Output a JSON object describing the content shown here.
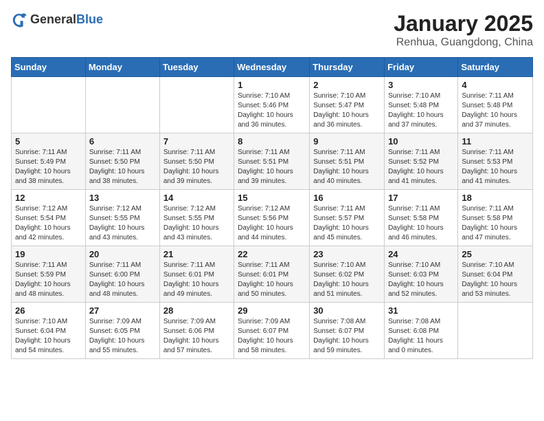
{
  "header": {
    "logo_general": "General",
    "logo_blue": "Blue",
    "month_title": "January 2025",
    "location": "Renhua, Guangdong, China"
  },
  "days_of_week": [
    "Sunday",
    "Monday",
    "Tuesday",
    "Wednesday",
    "Thursday",
    "Friday",
    "Saturday"
  ],
  "weeks": [
    [
      {
        "day": "",
        "info": ""
      },
      {
        "day": "",
        "info": ""
      },
      {
        "day": "",
        "info": ""
      },
      {
        "day": "1",
        "info": "Sunrise: 7:10 AM\nSunset: 5:46 PM\nDaylight: 10 hours and 36 minutes."
      },
      {
        "day": "2",
        "info": "Sunrise: 7:10 AM\nSunset: 5:47 PM\nDaylight: 10 hours and 36 minutes."
      },
      {
        "day": "3",
        "info": "Sunrise: 7:10 AM\nSunset: 5:48 PM\nDaylight: 10 hours and 37 minutes."
      },
      {
        "day": "4",
        "info": "Sunrise: 7:11 AM\nSunset: 5:48 PM\nDaylight: 10 hours and 37 minutes."
      }
    ],
    [
      {
        "day": "5",
        "info": "Sunrise: 7:11 AM\nSunset: 5:49 PM\nDaylight: 10 hours and 38 minutes."
      },
      {
        "day": "6",
        "info": "Sunrise: 7:11 AM\nSunset: 5:50 PM\nDaylight: 10 hours and 38 minutes."
      },
      {
        "day": "7",
        "info": "Sunrise: 7:11 AM\nSunset: 5:50 PM\nDaylight: 10 hours and 39 minutes."
      },
      {
        "day": "8",
        "info": "Sunrise: 7:11 AM\nSunset: 5:51 PM\nDaylight: 10 hours and 39 minutes."
      },
      {
        "day": "9",
        "info": "Sunrise: 7:11 AM\nSunset: 5:51 PM\nDaylight: 10 hours and 40 minutes."
      },
      {
        "day": "10",
        "info": "Sunrise: 7:11 AM\nSunset: 5:52 PM\nDaylight: 10 hours and 41 minutes."
      },
      {
        "day": "11",
        "info": "Sunrise: 7:11 AM\nSunset: 5:53 PM\nDaylight: 10 hours and 41 minutes."
      }
    ],
    [
      {
        "day": "12",
        "info": "Sunrise: 7:12 AM\nSunset: 5:54 PM\nDaylight: 10 hours and 42 minutes."
      },
      {
        "day": "13",
        "info": "Sunrise: 7:12 AM\nSunset: 5:55 PM\nDaylight: 10 hours and 43 minutes."
      },
      {
        "day": "14",
        "info": "Sunrise: 7:12 AM\nSunset: 5:55 PM\nDaylight: 10 hours and 43 minutes."
      },
      {
        "day": "15",
        "info": "Sunrise: 7:12 AM\nSunset: 5:56 PM\nDaylight: 10 hours and 44 minutes."
      },
      {
        "day": "16",
        "info": "Sunrise: 7:11 AM\nSunset: 5:57 PM\nDaylight: 10 hours and 45 minutes."
      },
      {
        "day": "17",
        "info": "Sunrise: 7:11 AM\nSunset: 5:58 PM\nDaylight: 10 hours and 46 minutes."
      },
      {
        "day": "18",
        "info": "Sunrise: 7:11 AM\nSunset: 5:58 PM\nDaylight: 10 hours and 47 minutes."
      }
    ],
    [
      {
        "day": "19",
        "info": "Sunrise: 7:11 AM\nSunset: 5:59 PM\nDaylight: 10 hours and 48 minutes."
      },
      {
        "day": "20",
        "info": "Sunrise: 7:11 AM\nSunset: 6:00 PM\nDaylight: 10 hours and 48 minutes."
      },
      {
        "day": "21",
        "info": "Sunrise: 7:11 AM\nSunset: 6:01 PM\nDaylight: 10 hours and 49 minutes."
      },
      {
        "day": "22",
        "info": "Sunrise: 7:11 AM\nSunset: 6:01 PM\nDaylight: 10 hours and 50 minutes."
      },
      {
        "day": "23",
        "info": "Sunrise: 7:10 AM\nSunset: 6:02 PM\nDaylight: 10 hours and 51 minutes."
      },
      {
        "day": "24",
        "info": "Sunrise: 7:10 AM\nSunset: 6:03 PM\nDaylight: 10 hours and 52 minutes."
      },
      {
        "day": "25",
        "info": "Sunrise: 7:10 AM\nSunset: 6:04 PM\nDaylight: 10 hours and 53 minutes."
      }
    ],
    [
      {
        "day": "26",
        "info": "Sunrise: 7:10 AM\nSunset: 6:04 PM\nDaylight: 10 hours and 54 minutes."
      },
      {
        "day": "27",
        "info": "Sunrise: 7:09 AM\nSunset: 6:05 PM\nDaylight: 10 hours and 55 minutes."
      },
      {
        "day": "28",
        "info": "Sunrise: 7:09 AM\nSunset: 6:06 PM\nDaylight: 10 hours and 57 minutes."
      },
      {
        "day": "29",
        "info": "Sunrise: 7:09 AM\nSunset: 6:07 PM\nDaylight: 10 hours and 58 minutes."
      },
      {
        "day": "30",
        "info": "Sunrise: 7:08 AM\nSunset: 6:07 PM\nDaylight: 10 hours and 59 minutes."
      },
      {
        "day": "31",
        "info": "Sunrise: 7:08 AM\nSunset: 6:08 PM\nDaylight: 11 hours and 0 minutes."
      },
      {
        "day": "",
        "info": ""
      }
    ]
  ]
}
